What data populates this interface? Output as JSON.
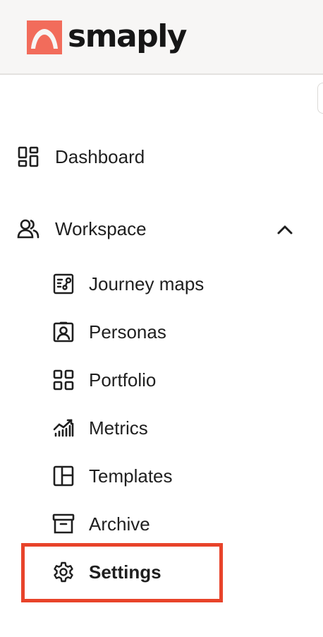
{
  "brand": {
    "name": "smaply",
    "accent": "#f26c5b"
  },
  "nav": {
    "dashboard": {
      "label": "Dashboard",
      "icon": "dashboard-icon"
    },
    "workspace": {
      "label": "Workspace",
      "icon": "users-icon",
      "expanded": true,
      "items": [
        {
          "label": "Journey maps",
          "icon": "journey-map-icon"
        },
        {
          "label": "Personas",
          "icon": "persona-badge-icon"
        },
        {
          "label": "Portfolio",
          "icon": "grid-icon"
        },
        {
          "label": "Metrics",
          "icon": "metrics-icon"
        },
        {
          "label": "Templates",
          "icon": "template-icon"
        },
        {
          "label": "Archive",
          "icon": "archive-icon"
        },
        {
          "label": "Settings",
          "icon": "gear-icon",
          "active": true
        }
      ]
    }
  },
  "highlight_color": "#e8432a"
}
